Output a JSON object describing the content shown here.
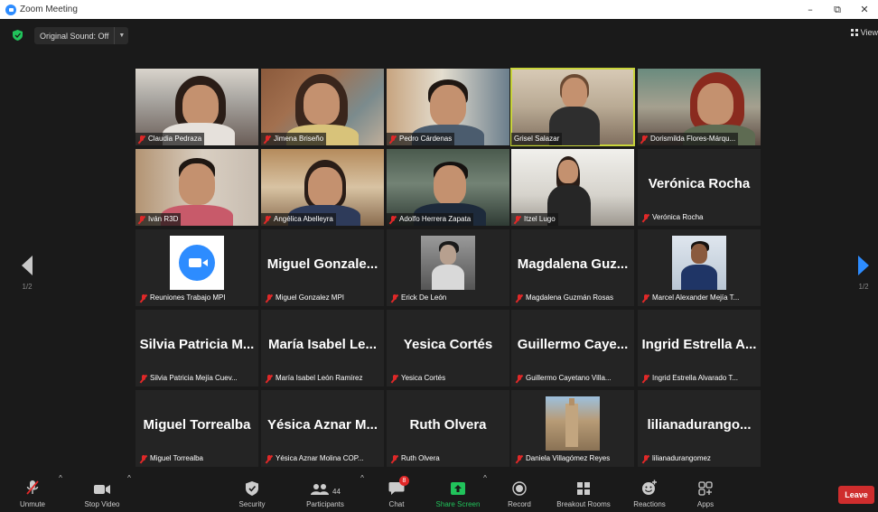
{
  "window": {
    "title": "Zoom Meeting",
    "controls": [
      "–",
      "⧉",
      "✕"
    ]
  },
  "topbar": {
    "original_sound": "Original Sound: Off",
    "view_label": "View"
  },
  "pager": {
    "left": "1/2",
    "right": "1/2"
  },
  "tiles": [
    {
      "name": "Claudia Pedraza",
      "type": "video",
      "muted": true
    },
    {
      "name": "Jimena Briseño",
      "type": "video",
      "muted": true
    },
    {
      "name": "Pedro Cárdenas",
      "type": "video",
      "muted": true
    },
    {
      "name": "Grisel Salazar",
      "type": "video",
      "muted": false,
      "active_speaker": true
    },
    {
      "name": "Dorismilda Flores-Márqu...",
      "type": "video",
      "muted": true
    },
    {
      "name": "Iván R3D",
      "type": "video",
      "muted": true
    },
    {
      "name": "Angélica Abelleyra",
      "type": "video",
      "muted": true
    },
    {
      "name": "Adolfo Herrera Zapata",
      "type": "video",
      "muted": true
    },
    {
      "name": "Itzel Lugo",
      "type": "video",
      "muted": true
    },
    {
      "name": "Verónica Rocha",
      "type": "name",
      "big_name": "Verónica Rocha",
      "muted": true
    },
    {
      "name": "Reuniones Trabajo MPI",
      "type": "logo",
      "muted": true
    },
    {
      "name": "Miguel Gonzalez MPI",
      "type": "name",
      "big_name": "Miguel Gonzale...",
      "muted": true
    },
    {
      "name": "Erick De León",
      "type": "photo",
      "muted": true
    },
    {
      "name": "Magdalena Guzmán Rosas",
      "type": "name",
      "big_name": "Magdalena Guz...",
      "muted": true
    },
    {
      "name": "Marcel Alexander Mejía T...",
      "type": "photo",
      "muted": true
    },
    {
      "name": "Silvia Patricia Mejía Cuev...",
      "type": "name",
      "big_name": "Silvia Patricia M...",
      "muted": true
    },
    {
      "name": "María Isabel León Ramírez",
      "type": "name",
      "big_name": "María Isabel Le...",
      "muted": true
    },
    {
      "name": "Yesica Cortés",
      "type": "name",
      "big_name": "Yesica Cortés",
      "muted": true
    },
    {
      "name": "Guillermo Cayetano Villa...",
      "type": "name",
      "big_name": "Guillermo Caye...",
      "muted": true
    },
    {
      "name": "Ingrid Estrella Alvarado T...",
      "type": "name",
      "big_name": "Ingrid Estrella A...",
      "muted": true
    },
    {
      "name": "Miguel Torrealba",
      "type": "name",
      "big_name": "Miguel Torrealba",
      "muted": true
    },
    {
      "name": "Yésica Aznar Molina COP...",
      "type": "name",
      "big_name": "Yésica Aznar M...",
      "muted": true
    },
    {
      "name": "Ruth Olvera",
      "type": "name",
      "big_name": "Ruth Olvera",
      "muted": true
    },
    {
      "name": "Daniela Villagómez Reyes",
      "type": "photo",
      "muted": true
    },
    {
      "name": "lilianadurangomez",
      "type": "name",
      "big_name": "lilianadurango...",
      "muted": true
    }
  ],
  "toolbar": {
    "unmute": "Unmute",
    "stop_video": "Stop Video",
    "security": "Security",
    "participants": "Participants",
    "participants_count": "44",
    "chat": "Chat",
    "chat_badge": "8",
    "share_screen": "Share Screen",
    "record": "Record",
    "breakout_rooms": "Breakout Rooms",
    "reactions": "Reactions",
    "apps": "Apps",
    "leave": "Leave"
  },
  "colors": {
    "accent": "#2d8cff",
    "leave": "#cf2d2d",
    "share": "#21c35b",
    "active_speaker": "#c8d43a",
    "muted": "#e02828"
  }
}
